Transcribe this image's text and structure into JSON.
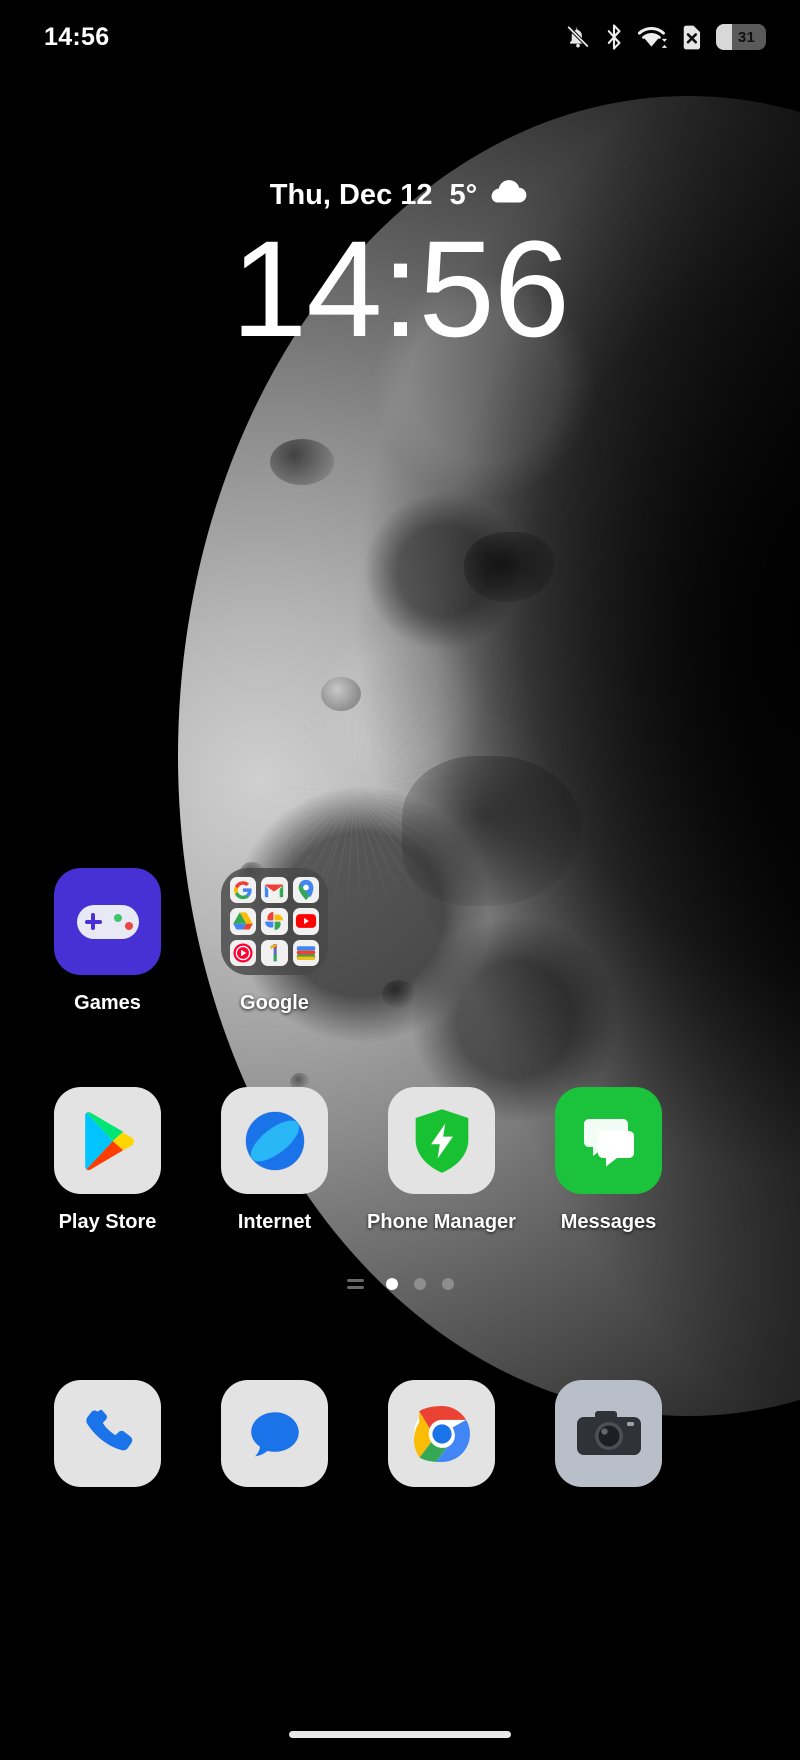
{
  "status_bar": {
    "time": "14:56",
    "icons": [
      {
        "name": "notifications-muted-icon",
        "label": "Silent"
      },
      {
        "name": "bluetooth-icon",
        "label": "Bluetooth"
      },
      {
        "name": "wifi-icon",
        "label": "Wi-Fi"
      },
      {
        "name": "no-sim-icon",
        "label": "No SIM"
      }
    ],
    "battery": {
      "level": "31",
      "percent": 31
    }
  },
  "clock_widget": {
    "date": "Thu, Dec 12",
    "temperature": "5°",
    "weather_icon": "cloud-icon",
    "time": "14:56"
  },
  "home_screen": {
    "rows": [
      {
        "apps": [
          {
            "label": "Games",
            "icon": "games-folder-icon",
            "type": "folder"
          },
          {
            "label": "Google",
            "icon": "google-folder-icon",
            "type": "folder",
            "contents": [
              {
                "label": "Google",
                "icon": "google-search-icon"
              },
              {
                "label": "Gmail",
                "icon": "gmail-icon"
              },
              {
                "label": "Maps",
                "icon": "maps-icon"
              },
              {
                "label": "Drive",
                "icon": "drive-icon"
              },
              {
                "label": "Photos",
                "icon": "photos-icon"
              },
              {
                "label": "YouTube",
                "icon": "youtube-icon"
              },
              {
                "label": "YouTube Music",
                "icon": "youtube-music-icon"
              },
              {
                "label": "Google One",
                "icon": "google-one-icon"
              },
              {
                "label": "Wallet",
                "icon": "wallet-icon"
              }
            ]
          }
        ]
      },
      {
        "apps": [
          {
            "label": "Play Store",
            "icon": "play-store-icon",
            "type": "app"
          },
          {
            "label": "Internet",
            "icon": "internet-browser-icon",
            "type": "app"
          },
          {
            "label": "Phone Manager",
            "icon": "phone-manager-icon",
            "type": "app"
          },
          {
            "label": "Messages",
            "icon": "messages-icon",
            "type": "app"
          }
        ]
      }
    ]
  },
  "page_indicator": {
    "pages": 4,
    "active_index": 1,
    "first_is_feed": true
  },
  "dock": {
    "apps": [
      {
        "label": "Phone",
        "icon": "phone-icon"
      },
      {
        "label": "Messages",
        "icon": "sms-icon"
      },
      {
        "label": "Chrome",
        "icon": "chrome-icon"
      },
      {
        "label": "Camera",
        "icon": "camera-icon"
      }
    ]
  },
  "navigation": {
    "gesture_bar": "home-gesture-bar"
  },
  "colors": {
    "background": "#000000",
    "games_purple": "#4730d4",
    "messages_green": "#1bc33c",
    "icon_tile": "#e3e3e3",
    "accent_white": "#ffffff"
  }
}
